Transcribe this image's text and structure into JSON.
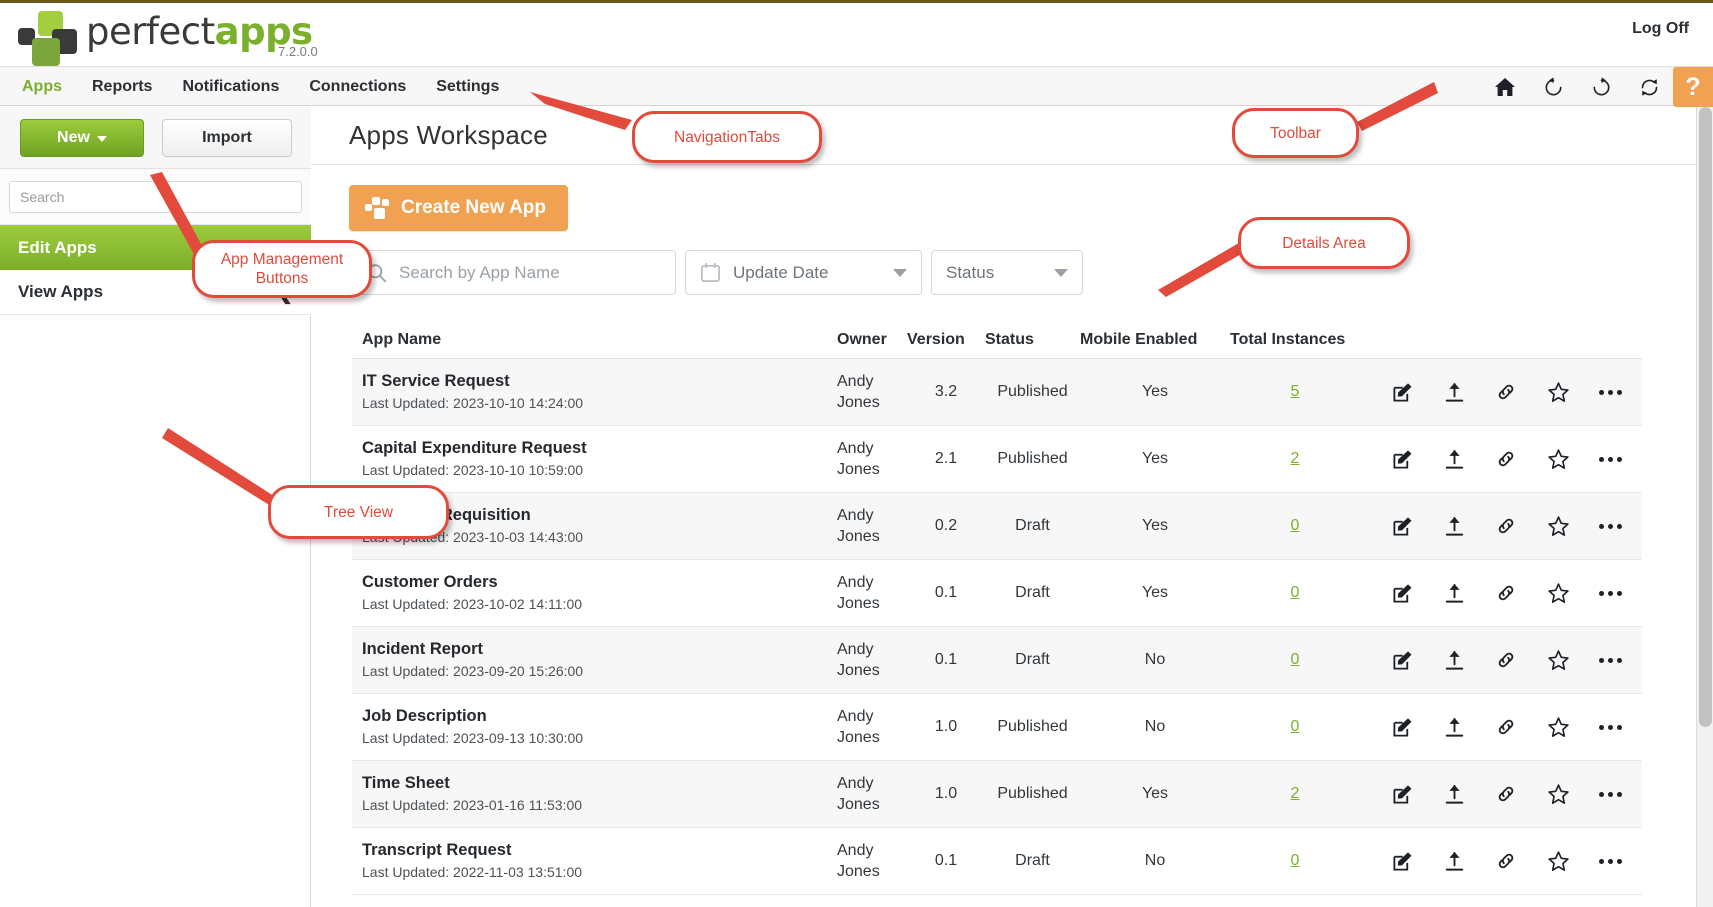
{
  "brand": {
    "name_part1": "perfect",
    "name_part2": "apps",
    "version": "7.2.0.0",
    "logoff": "Log Off",
    "accent_green": "#7ab02c",
    "accent_orange": "#f0a151"
  },
  "nav": {
    "tabs": [
      {
        "label": "Apps",
        "active": true
      },
      {
        "label": "Reports",
        "active": false
      },
      {
        "label": "Notifications",
        "active": false
      },
      {
        "label": "Connections",
        "active": false
      },
      {
        "label": "Settings",
        "active": false
      }
    ],
    "toolbar_icons": [
      "home-icon",
      "undo-icon",
      "redo-icon",
      "sync-icon"
    ],
    "help_label": "?"
  },
  "sidebar": {
    "new_button": "New",
    "import_button": "Import",
    "search_placeholder": "Search",
    "search_value": "",
    "items": [
      {
        "label": "Edit Apps",
        "selected": true
      },
      {
        "label": "View Apps",
        "selected": false
      }
    ],
    "collapse_icon": "❮"
  },
  "main": {
    "page_title": "Apps Workspace",
    "create_button": "Create New App",
    "filters": {
      "search_placeholder": "Search by App Name",
      "search_value": "",
      "date_label": "Update Date",
      "status_label": "Status"
    },
    "table": {
      "columns": [
        "App Name",
        "Owner",
        "Version",
        "Status",
        "Mobile Enabled",
        "Total Instances"
      ],
      "last_updated_prefix": "Last Updated: ",
      "row_actions": [
        "edit-icon",
        "upload-icon",
        "link-icon",
        "star-icon",
        "more-icon"
      ],
      "rows": [
        {
          "name": "IT Service Request",
          "updated": "Last Updated: 2023-10-10 14:24:00",
          "owner_first": "Andy",
          "owner_last": "Jones",
          "version": "3.2",
          "status": "Published",
          "mobile": "Yes",
          "instances": "5"
        },
        {
          "name": "Capital Expenditure Request",
          "updated": "Last Updated: 2023-10-10 10:59:00",
          "owner_first": "Andy",
          "owner_last": "Jones",
          "version": "2.1",
          "status": "Published",
          "mobile": "Yes",
          "instances": "2"
        },
        {
          "name": "Purchase Requisition",
          "updated": "Last Updated: 2023-10-03 14:43:00",
          "owner_first": "Andy",
          "owner_last": "Jones",
          "version": "0.2",
          "status": "Draft",
          "mobile": "Yes",
          "instances": "0"
        },
        {
          "name": "Customer Orders",
          "updated": "Last Updated: 2023-10-02 14:11:00",
          "owner_first": "Andy",
          "owner_last": "Jones",
          "version": "0.1",
          "status": "Draft",
          "mobile": "Yes",
          "instances": "0"
        },
        {
          "name": "Incident Report",
          "updated": "Last Updated: 2023-09-20 15:26:00",
          "owner_first": "Andy",
          "owner_last": "Jones",
          "version": "0.1",
          "status": "Draft",
          "mobile": "No",
          "instances": "0"
        },
        {
          "name": "Job Description",
          "updated": "Last Updated: 2023-09-13 10:30:00",
          "owner_first": "Andy",
          "owner_last": "Jones",
          "version": "1.0",
          "status": "Published",
          "mobile": "No",
          "instances": "0"
        },
        {
          "name": "Time Sheet",
          "updated": "Last Updated: 2023-01-16 11:53:00",
          "owner_first": "Andy",
          "owner_last": "Jones",
          "version": "1.0",
          "status": "Published",
          "mobile": "Yes",
          "instances": "2"
        },
        {
          "name": "Transcript Request",
          "updated": "Last Updated: 2022-11-03 13:51:00",
          "owner_first": "Andy",
          "owner_last": "Jones",
          "version": "0.1",
          "status": "Draft",
          "mobile": "No",
          "instances": "0"
        }
      ]
    }
  },
  "annotations": {
    "color": "#e24a3b",
    "items": [
      {
        "label": "NavigationTabs"
      },
      {
        "label": "Toolbar"
      },
      {
        "label": "App Management\nButtons"
      },
      {
        "label": "Details Area"
      },
      {
        "label": "Tree View"
      }
    ]
  }
}
